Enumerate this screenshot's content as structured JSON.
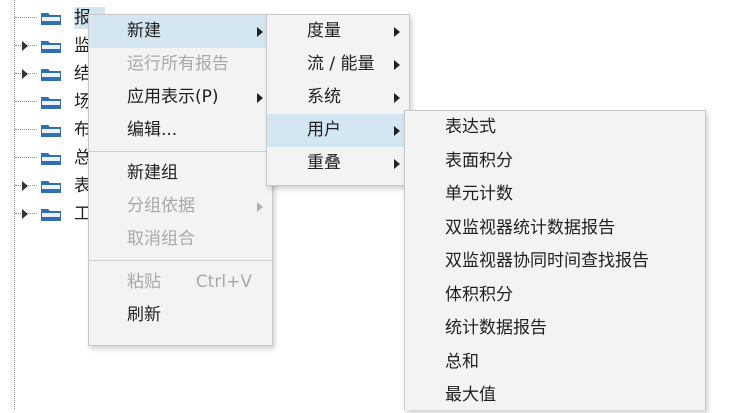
{
  "tree": {
    "items": [
      {
        "label": "报",
        "expandable": false,
        "selected": true
      },
      {
        "label": "监",
        "expandable": true,
        "selected": false
      },
      {
        "label": "结",
        "expandable": true,
        "selected": false
      },
      {
        "label": "场",
        "expandable": false,
        "selected": false
      },
      {
        "label": "布",
        "expandable": false,
        "selected": false
      },
      {
        "label": "总",
        "expandable": false,
        "selected": false
      },
      {
        "label": "表",
        "expandable": true,
        "selected": false
      },
      {
        "label": "工",
        "expandable": true,
        "selected": false
      }
    ],
    "folder_color": "#2f6fb3"
  },
  "context_menu": {
    "new": "新建",
    "run_all_reports": "运行所有报告",
    "apply_view": "应用表示(P)",
    "edit": "编辑...",
    "new_group": "新建组",
    "group_by": "分组依据",
    "ungroup": "取消组合",
    "paste": "粘贴",
    "paste_shortcut": "Ctrl+V",
    "refresh": "刷新"
  },
  "submenu_new": {
    "metric": "度量",
    "flow_energy": "流 / 能量",
    "system": "系统",
    "user": "用户",
    "overlay": "重叠"
  },
  "submenu_user": {
    "items": [
      "表达式",
      "表面积分",
      "单元计数",
      "双监视器统计数据报告",
      "双监视器协同时间查找报告",
      "体积积分",
      "统计数据报告",
      "总和",
      "最大值"
    ]
  },
  "colors": {
    "highlight": "#d5e6f3",
    "menu_bg": "#f3f3f3",
    "disabled_text": "#a9a9a9"
  }
}
